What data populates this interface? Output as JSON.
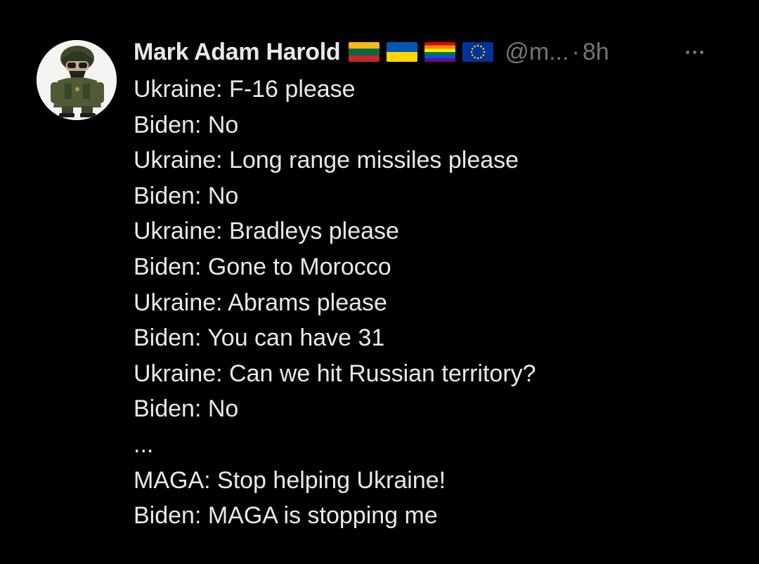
{
  "tweet": {
    "author": {
      "name": "Mark Adam Harold",
      "handle": "@m...",
      "flags": [
        "lithuania-flag",
        "ukraine-flag",
        "rainbow-flag",
        "eu-flag"
      ]
    },
    "separator": "·",
    "time": "8h",
    "more_icon": "more-horizontal-icon",
    "lines": [
      "Ukraine: F-16 please",
      "Biden: No",
      "Ukraine: Long range missiles please",
      "Biden: No",
      "Ukraine: Bradleys please",
      "Biden: Gone to Morocco",
      "Ukraine: Abrams please",
      "Biden: You can have 31",
      "Ukraine: Can we hit Russian territory?",
      "Biden: No",
      "...",
      "MAGA: Stop helping Ukraine!",
      "Biden: MAGA is stopping me"
    ]
  },
  "colors": {
    "background": "#000000",
    "text_primary": "#e7e9ea",
    "text_secondary": "#71767b"
  }
}
